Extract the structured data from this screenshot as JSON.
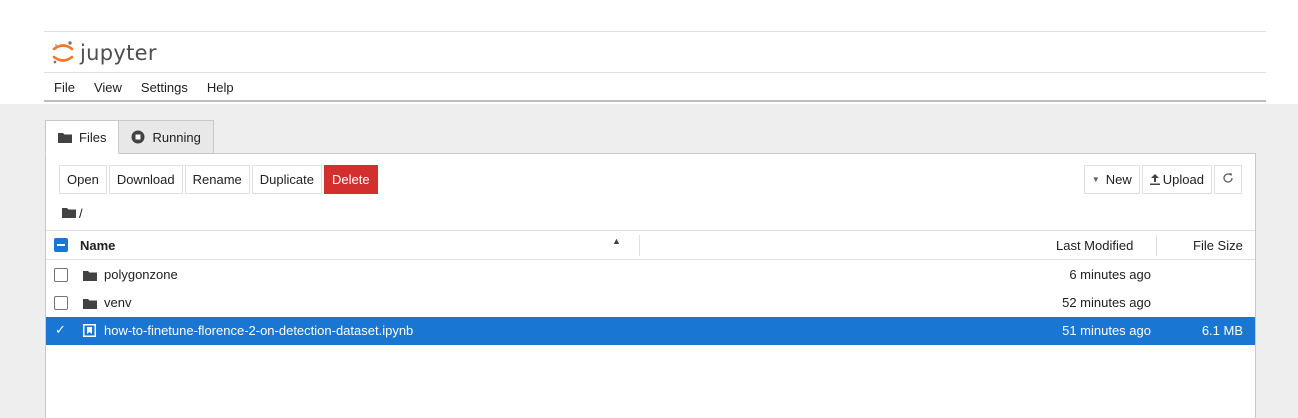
{
  "header": {
    "logo_text": "jupyter"
  },
  "menu": {
    "items": [
      "File",
      "View",
      "Settings",
      "Help"
    ]
  },
  "tabs": [
    {
      "label": "Files",
      "active": true
    },
    {
      "label": "Running",
      "active": false
    }
  ],
  "toolbar": {
    "open": "Open",
    "download": "Download",
    "rename": "Rename",
    "duplicate": "Duplicate",
    "delete": "Delete",
    "new": "New",
    "upload": "Upload"
  },
  "breadcrumb": {
    "path": "/"
  },
  "columns": {
    "name": "Name",
    "last_modified": "Last Modified",
    "file_size": "File Size"
  },
  "files": [
    {
      "name": "polygonzone",
      "type": "folder",
      "modified": "6 minutes ago",
      "size": "",
      "selected": false
    },
    {
      "name": "venv",
      "type": "folder",
      "modified": "52 minutes ago",
      "size": "",
      "selected": false
    },
    {
      "name": "how-to-finetune-florence-2-on-detection-dataset.ipynb",
      "type": "notebook",
      "modified": "51 minutes ago",
      "size": "6.1 MB",
      "selected": true
    }
  ],
  "colors": {
    "accent": "#1976d2",
    "danger": "#d32f2f",
    "logo_orange": "#f37726"
  }
}
